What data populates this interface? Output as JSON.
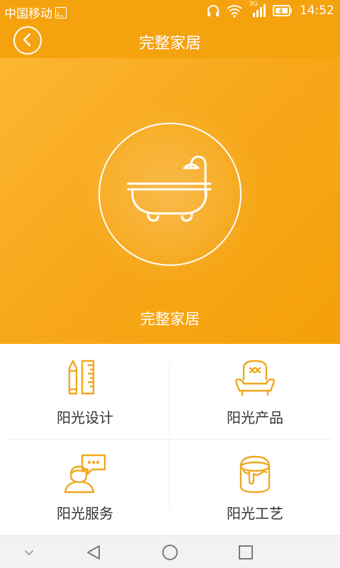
{
  "status_bar": {
    "carrier": "中国移动",
    "network": "3G",
    "time": "14:52"
  },
  "header": {
    "title": "完整家居",
    "back_icon": "chevron-left-icon"
  },
  "hero": {
    "icon": "bathtub-icon",
    "title": "完整家居"
  },
  "grid": {
    "items": [
      {
        "label": "阳光设计",
        "icon": "pencil-ruler-icon"
      },
      {
        "label": "阳光产品",
        "icon": "armchair-icon"
      },
      {
        "label": "阳光服务",
        "icon": "customer-service-icon"
      },
      {
        "label": "阳光工艺",
        "icon": "paint-bucket-icon"
      }
    ]
  },
  "nav_bar": {
    "icons": [
      "chevron-down-icon",
      "back-triangle-icon",
      "home-circle-icon",
      "recents-square-icon"
    ]
  },
  "colors": {
    "accent": "#f5a20f",
    "icon_stroke": "#f0a81e",
    "label_text": "#333333"
  }
}
